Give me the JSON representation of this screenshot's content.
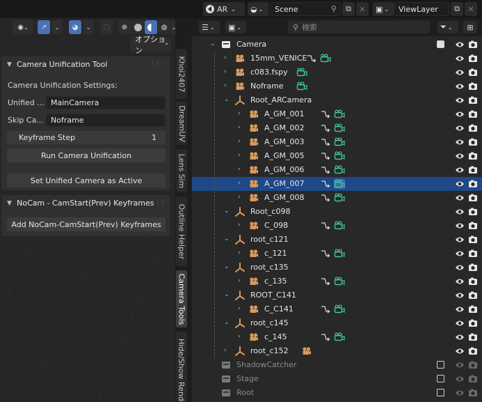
{
  "topbar": {
    "view_layer_scene": "AR",
    "scene_name": "Scene",
    "view_layer_name": "ViewLayer"
  },
  "viewport": {
    "options_label": "オプション"
  },
  "panel_camera_unification": {
    "title": "Camera Unification Tool",
    "settings_label": "Camera Unification Settings:",
    "unified_label": "Unified ...",
    "unified_value": "MainCamera",
    "skip_label": "Skip Ca...",
    "skip_value": "Noframe",
    "keyframe_step_label": "Keyframe Step",
    "keyframe_step_value": "1",
    "run_button": "Run Camera Unification",
    "set_active_button": "Set Unified Camera as Active"
  },
  "panel_nocam": {
    "title": "NoCam - CamStart(Prev) Keyframes",
    "add_button": "Add NoCam-CamStart(Prev) Keyframes"
  },
  "sidebar_tabs": [
    "Khoi2407",
    "DreamUV",
    "Lens Sim",
    "Outline Helper",
    "Camera Tools",
    "Hide/Show Render"
  ],
  "outliner": {
    "search_placeholder": "検索",
    "rows": [
      {
        "name": "Camera",
        "type": "collection",
        "depth": 0,
        "arrow": "down",
        "checkbox": "on"
      },
      {
        "name": "15mm_VENICE",
        "type": "camera",
        "depth": 1,
        "arrow": "right",
        "extras": true
      },
      {
        "name": "c083.fspy",
        "type": "camera",
        "depth": 1,
        "arrow": "right",
        "extras": "cam"
      },
      {
        "name": "Noframe",
        "type": "camera",
        "depth": 1,
        "arrow": "right",
        "extras": "cam"
      },
      {
        "name": "Root_ARCamera",
        "type": "empty",
        "depth": 1,
        "arrow": "down"
      },
      {
        "name": "A_GM_001",
        "type": "camera",
        "depth": 2,
        "arrow": "right",
        "extras": true
      },
      {
        "name": "A_GM_002",
        "type": "camera",
        "depth": 2,
        "arrow": "right",
        "extras": true
      },
      {
        "name": "A_GM_003",
        "type": "camera",
        "depth": 2,
        "arrow": "right",
        "extras": true
      },
      {
        "name": "A_GM_005",
        "type": "camera",
        "depth": 2,
        "arrow": "right",
        "extras": true
      },
      {
        "name": "A_GM_006",
        "type": "camera",
        "depth": 2,
        "arrow": "right",
        "extras": true
      },
      {
        "name": "A_GM_007",
        "type": "camera",
        "depth": 2,
        "arrow": "right",
        "extras": true,
        "selected": true
      },
      {
        "name": "A_GM_008",
        "type": "camera",
        "depth": 2,
        "arrow": "right",
        "extras": true
      },
      {
        "name": "Root_c098",
        "type": "empty",
        "depth": 1,
        "arrow": "down"
      },
      {
        "name": "C_098",
        "type": "camera",
        "depth": 2,
        "arrow": "right",
        "extras": true
      },
      {
        "name": "root_c121",
        "type": "empty",
        "depth": 1,
        "arrow": "down"
      },
      {
        "name": "c_121",
        "type": "camera",
        "depth": 2,
        "arrow": "right",
        "extras": true
      },
      {
        "name": "root_c135",
        "type": "empty",
        "depth": 1,
        "arrow": "down"
      },
      {
        "name": "c_135",
        "type": "camera",
        "depth": 2,
        "arrow": "right",
        "extras": true
      },
      {
        "name": "ROOT_C141",
        "type": "empty",
        "depth": 1,
        "arrow": "down"
      },
      {
        "name": "C_C141",
        "type": "camera",
        "depth": 2,
        "arrow": "right",
        "extras": "constraint"
      },
      {
        "name": "root_c145",
        "type": "empty",
        "depth": 1,
        "arrow": "down"
      },
      {
        "name": "c_145",
        "type": "camera",
        "depth": 2,
        "arrow": "right",
        "extras": true
      },
      {
        "name": "root_c152",
        "type": "empty",
        "depth": 1,
        "arrow": "right",
        "extras": "orangecam"
      },
      {
        "name": "ShadowCatcher",
        "type": "collection",
        "depth": 0,
        "checkbox": "off",
        "dim": true
      },
      {
        "name": "Stage",
        "type": "collection",
        "depth": 0,
        "checkbox": "off",
        "dim": true
      },
      {
        "name": "Root",
        "type": "collection",
        "depth": 0,
        "checkbox": "off",
        "dim": true
      }
    ]
  },
  "colors": {
    "accent": "#4772b3",
    "selected_row": "#1e4888",
    "camera_orange": "#d99a5e",
    "data_green": "#3fc5a0",
    "panel_bg": "#303030"
  }
}
